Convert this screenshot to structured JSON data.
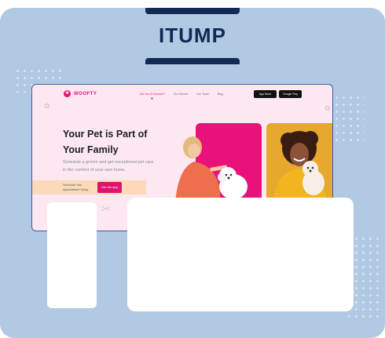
{
  "brand": {
    "title": "ITUMP"
  },
  "site": {
    "logo_text": "WOOFTY",
    "nav": [
      "Are You A Groomer?",
      "Our Service",
      "Our Team",
      "Blog"
    ],
    "store_buttons": [
      "App Store",
      "Google Play"
    ],
    "hero": {
      "title_line1": "Your Pet is Part of",
      "title_line2": "Your Family",
      "subtitle": "Schedule a groom and get exceptional pet care in the comfort of your own home."
    },
    "cta": {
      "text": "Schedule Your Appointment Today",
      "button_label": "Get the app"
    }
  },
  "colors": {
    "background": "#b1c9e3",
    "brand_navy": "#102a55",
    "accent_pink": "#e0136e",
    "site_bg": "#fde8f1",
    "photo_card_pink": "#e8127a",
    "photo_card_yellow": "#e6a92e"
  }
}
